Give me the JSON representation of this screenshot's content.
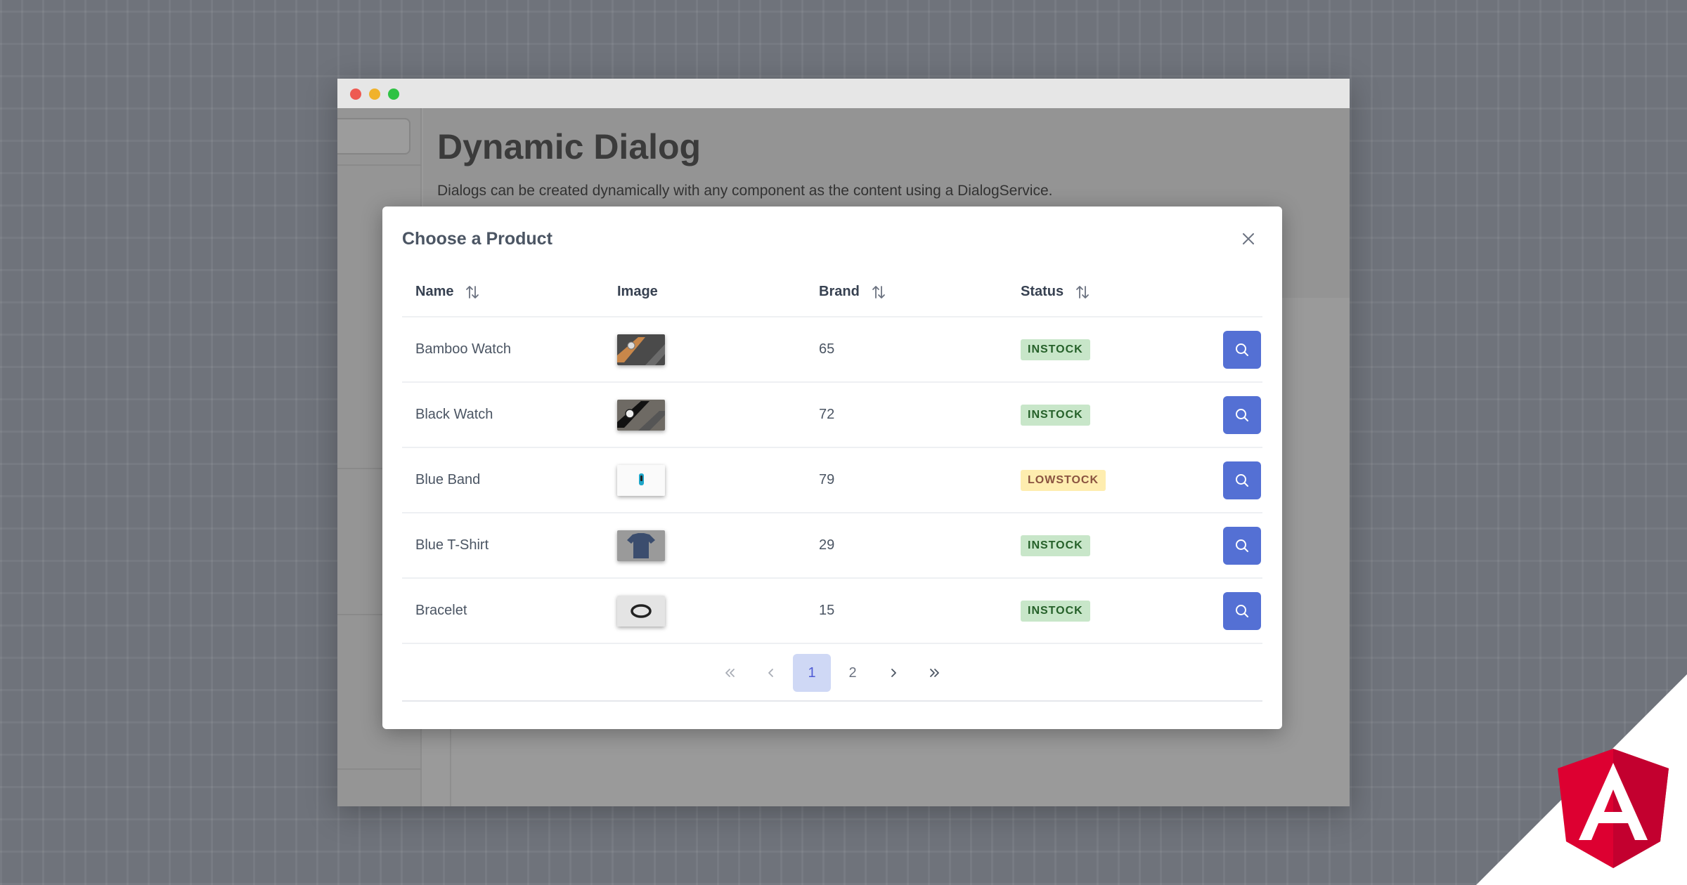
{
  "page": {
    "title": "Dynamic Dialog",
    "description": "Dialogs can be created dynamically with any component as the content using a DialogService."
  },
  "dialog": {
    "title": "Choose a Product",
    "columns": {
      "name": "Name",
      "image": "Image",
      "brand": "Brand",
      "status": "Status"
    },
    "rows": [
      {
        "name": "Bamboo Watch",
        "image": "bamboo-watch-image",
        "brand": "65",
        "status": "INSTOCK",
        "status_type": "in"
      },
      {
        "name": "Black Watch",
        "image": "black-watch-image",
        "brand": "72",
        "status": "INSTOCK",
        "status_type": "in"
      },
      {
        "name": "Blue Band",
        "image": "blue-band-image",
        "brand": "79",
        "status": "LOWSTOCK",
        "status_type": "low"
      },
      {
        "name": "Blue T-Shirt",
        "image": "blue-tshirt-image",
        "brand": "29",
        "status": "INSTOCK",
        "status_type": "in"
      },
      {
        "name": "Bracelet",
        "image": "bracelet-image",
        "brand": "15",
        "status": "INSTOCK",
        "status_type": "in"
      }
    ],
    "paginator": {
      "pages": [
        "1",
        "2"
      ],
      "current": "1"
    }
  },
  "colors": {
    "accent": "#5470d4",
    "instock_bg": "#c8e6c9",
    "instock_text": "#256029",
    "lowstock_bg": "#feedaf",
    "lowstock_text": "#8a5340",
    "angular_red": "#dd0031"
  }
}
